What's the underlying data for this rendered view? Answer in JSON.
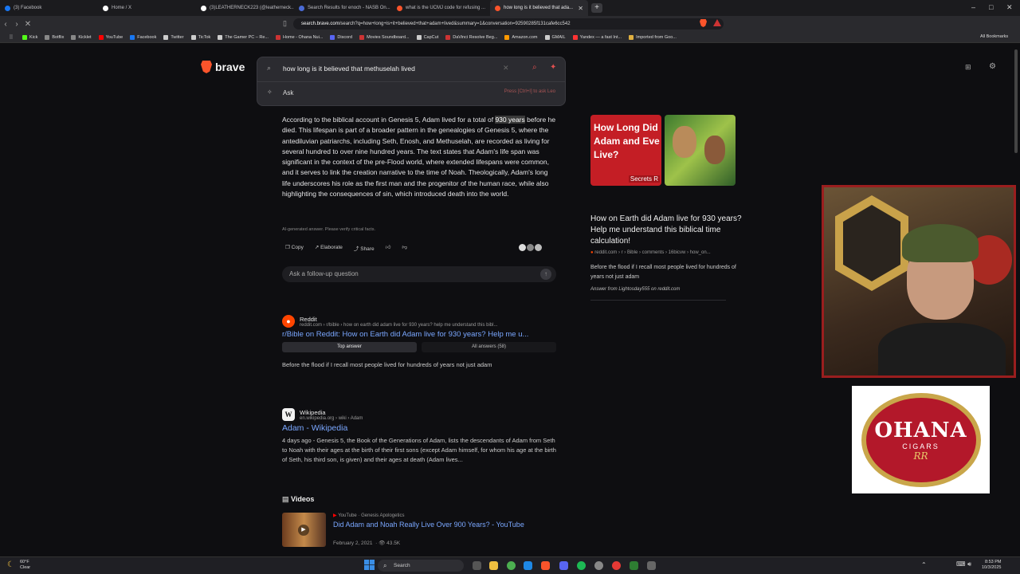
{
  "browser": {
    "tabs": [
      {
        "label": "(3) Facebook",
        "color": "#1877f2"
      },
      {
        "label": "Home / X",
        "color": "#ffffff"
      },
      {
        "label": "(3)LEATHERNECK223 (@leatherneck...",
        "color": "#ffffff"
      },
      {
        "label": "Search Results for enoch - NASB On...",
        "color": "#4a6bd6"
      },
      {
        "label": "what is the UCMJ code for refusing ...",
        "color": "#fb542b"
      },
      {
        "label": "how long is it believed that ada...",
        "color": "#fb542b",
        "active": true
      }
    ],
    "url": {
      "host": "search.brave.com",
      "path": "/search?q=how+long+is+it+believed+that+adam+lived&summary=1&conversation=92590285f131cafe6cc542"
    },
    "bookmarks": [
      {
        "label": "Kick",
        "color": "#53fc18"
      },
      {
        "label": "Botflix",
        "color": "#888888"
      },
      {
        "label": "Kicklet",
        "color": "#888888"
      },
      {
        "label": "YouTube",
        "color": "#ff0000"
      },
      {
        "label": "Facebook",
        "color": "#1877f2"
      },
      {
        "label": "Twitter",
        "color": "#cccccc"
      },
      {
        "label": "TicTok",
        "color": "#cccccc"
      },
      {
        "label": "The Gamer PC – Re...",
        "color": "#cccccc"
      },
      {
        "label": "Home - Ohana Nui...",
        "color": "#cc3333"
      },
      {
        "label": "Discord",
        "color": "#5865f2"
      },
      {
        "label": "Movies Soundboard...",
        "color": "#cc3333"
      },
      {
        "label": "CapCut",
        "color": "#cccccc"
      },
      {
        "label": "DaVinci Resolve Beg...",
        "color": "#cc3333"
      },
      {
        "label": "Amazon.com",
        "color": "#ff9900"
      },
      {
        "label": "GMAIL",
        "color": "#cccccc"
      },
      {
        "label": "Yandex — a fast Int...",
        "color": "#ff3333"
      },
      {
        "label": "Imported from Goo...",
        "color": "#e0b040"
      }
    ],
    "all_bookmarks": "All Bookmarks"
  },
  "search": {
    "brand": "brave",
    "query": "how long is it believed that methuselah lived",
    "ask_label": "Ask",
    "hint": "Press [Ctrl+I] to ask Leo"
  },
  "answer": {
    "p1": "According to the biblical account in Genesis 5, Adam lived for a total of ",
    "highlight": "930 years",
    "p2": " before he died.  This lifespan is part of a broader pattern in the genealogies of Genesis 5, where the antediluvian patriarchs, including Seth, Enosh, and Methuselah, are recorded as living for several hundred to over nine hundred years.  The text states that Adam's life span was significant in the context of the pre-Flood world, where extended lifespans were common, and it serves to link the creation narrative to the time of Noah.  Theologically, Adam's long life underscores his role as the first man and the progenitor of the human race, while also highlighting the consequences of sin, which introduced death into the world.",
    "disclaimer": "AI-generated answer. Please verify critical facts.",
    "actions": [
      "Copy",
      "Elaborate",
      "Share"
    ],
    "followup_placeholder": "Ask a follow-up question"
  },
  "results": [
    {
      "site": "Reddit",
      "path": "reddit.com › r/bible › how on earth did adam live for 930 years? help me understand this bibl...",
      "title": "r/Bible on Reddit: How on Earth did Adam live for 930 years? Help me u...",
      "tabs": [
        "Top answer",
        "All answers (58)"
      ],
      "desc": "Before the flood if I recall most people lived for hundreds of years not just adam"
    },
    {
      "site": "Wikipedia",
      "path": "en.wikipedia.org › wiki › Adam",
      "title": "Adam - Wikipedia",
      "desc": "4 days ago - Genesis 5, the Book of the Generations of Adam, lists the descendants of Adam from Seth to Noah with their ages at the birth of their first sons (except Adam himself, for whom his age at the birth of Seth, his third son, is given) and their ages at death (Adam lives..."
    }
  ],
  "videos": {
    "heading": "Videos",
    "item": {
      "channel": "YouTube",
      "author": "Genesis Apologetics",
      "title": "Did Adam and Noah Really Live Over 900 Years? - YouTube",
      "date": "February 2, 2021",
      "views": "43.5K"
    }
  },
  "sidebar": {
    "thumb_text": "How Long Did Adam and Eve Live?",
    "thumb_tag": "Secrets R",
    "title": "How on Earth did Adam live for 930 years? Help me understand this biblical time calculation!",
    "source": "reddit.com › r › Bible › comments › 16bicvw › how_on...",
    "desc": "Before the flood if I recall most people lived for hundreds of years not just adam",
    "answer_from": "Answer from Lightosday555 on reddit.com"
  },
  "overlay": {
    "logo_name": "OHANA",
    "logo_sub": "CIGARS",
    "logo_mono": "RR"
  },
  "taskbar": {
    "weather_temp": "60°F",
    "weather_text": "Clear",
    "search_placeholder": "Search",
    "time": "8:53 PM",
    "date": "10/3/2025"
  }
}
